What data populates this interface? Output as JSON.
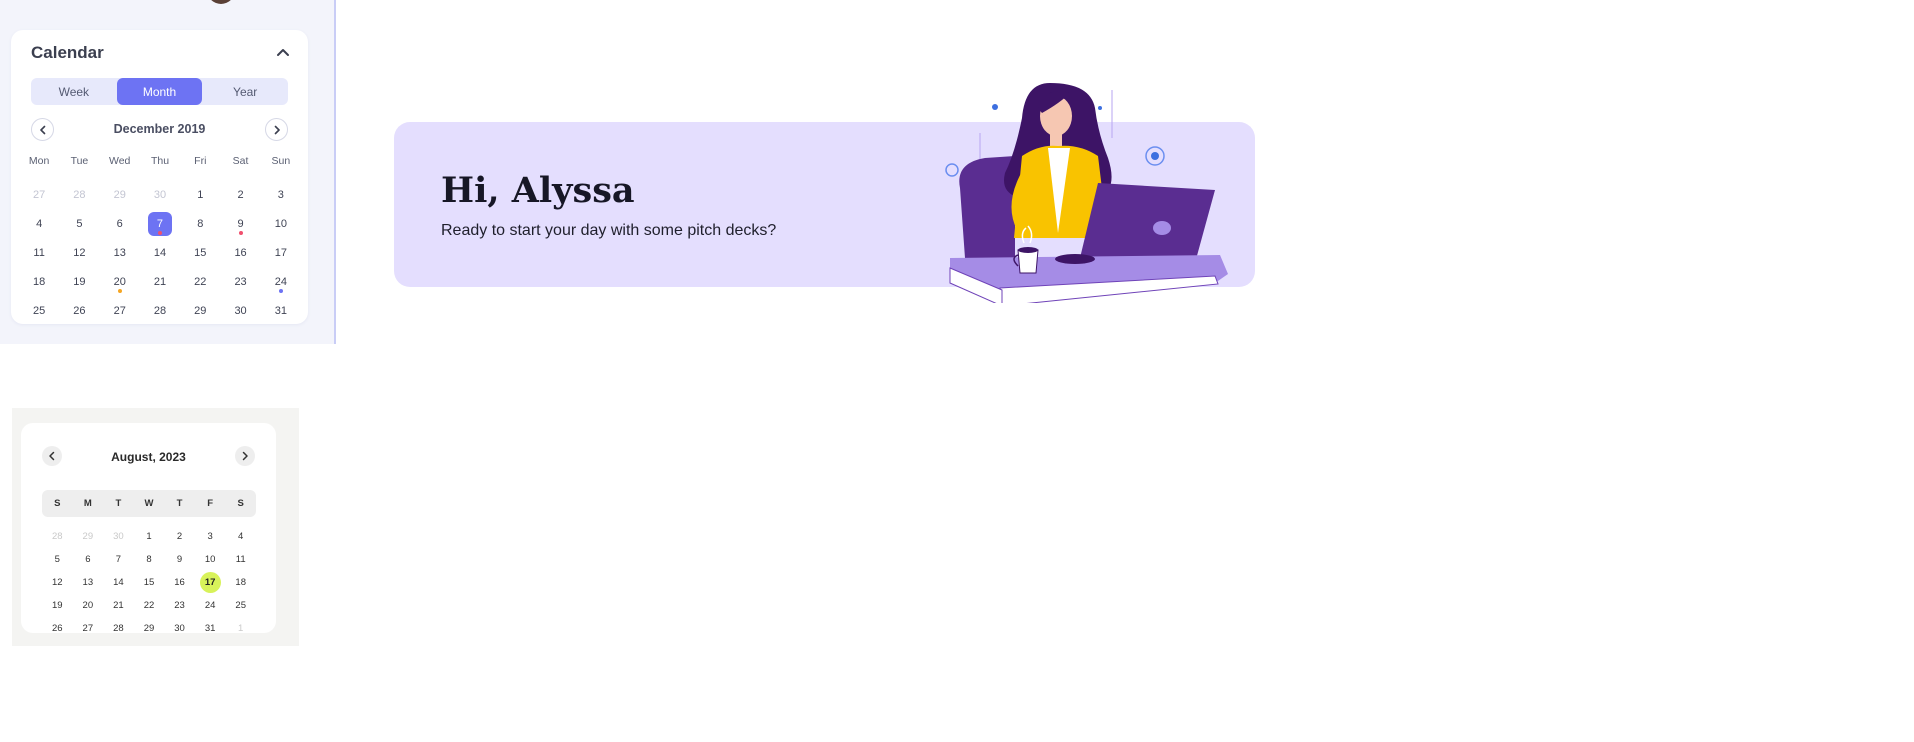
{
  "calendar": {
    "title": "Calendar",
    "views": [
      "Week",
      "Month",
      "Year"
    ],
    "active_view": "Month",
    "month_label": "December 2019",
    "weekdays": [
      "Mon",
      "Tue",
      "Wed",
      "Thu",
      "Fri",
      "Sat",
      "Sun"
    ],
    "accent_color": "#6d73f3",
    "weeks": [
      [
        {
          "d": "27",
          "muted": true
        },
        {
          "d": "28",
          "muted": true
        },
        {
          "d": "29",
          "muted": true
        },
        {
          "d": "30",
          "muted": true
        },
        {
          "d": "1"
        },
        {
          "d": "2"
        },
        {
          "d": "3"
        }
      ],
      [
        {
          "d": "4"
        },
        {
          "d": "5"
        },
        {
          "d": "6"
        },
        {
          "d": "7",
          "selected": true,
          "dot": "#f0506e"
        },
        {
          "d": "8"
        },
        {
          "d": "9",
          "dot": "#f0506e"
        },
        {
          "d": "10"
        }
      ],
      [
        {
          "d": "11"
        },
        {
          "d": "12"
        },
        {
          "d": "13"
        },
        {
          "d": "14"
        },
        {
          "d": "15"
        },
        {
          "d": "16"
        },
        {
          "d": "17"
        }
      ],
      [
        {
          "d": "18"
        },
        {
          "d": "19"
        },
        {
          "d": "20",
          "dot": "#f5a623"
        },
        {
          "d": "21"
        },
        {
          "d": "22"
        },
        {
          "d": "23"
        },
        {
          "d": "24",
          "dot": "#6d73f3"
        }
      ],
      [
        {
          "d": "25"
        },
        {
          "d": "26"
        },
        {
          "d": "27"
        },
        {
          "d": "28"
        },
        {
          "d": "29"
        },
        {
          "d": "30"
        },
        {
          "d": "31"
        }
      ]
    ]
  },
  "banner": {
    "greeting": "Hi, Alyssa",
    "subtitle": "Ready to start your day with some pitch decks?",
    "background": "#e4defe"
  },
  "mini_calendar": {
    "title": "August, 2023",
    "weekdays": [
      "S",
      "M",
      "T",
      "W",
      "T",
      "F",
      "S"
    ],
    "today_color": "#d8f25a",
    "weeks": [
      [
        {
          "d": "28",
          "muted": true
        },
        {
          "d": "29",
          "muted": true
        },
        {
          "d": "30",
          "muted": true
        },
        {
          "d": "1"
        },
        {
          "d": "2"
        },
        {
          "d": "3"
        },
        {
          "d": "4"
        }
      ],
      [
        {
          "d": "5"
        },
        {
          "d": "6"
        },
        {
          "d": "7"
        },
        {
          "d": "8"
        },
        {
          "d": "9"
        },
        {
          "d": "10"
        },
        {
          "d": "11"
        }
      ],
      [
        {
          "d": "12"
        },
        {
          "d": "13"
        },
        {
          "d": "14"
        },
        {
          "d": "15"
        },
        {
          "d": "16"
        },
        {
          "d": "17",
          "today": true
        },
        {
          "d": "18"
        }
      ],
      [
        {
          "d": "19"
        },
        {
          "d": "20"
        },
        {
          "d": "21"
        },
        {
          "d": "22"
        },
        {
          "d": "23"
        },
        {
          "d": "24"
        },
        {
          "d": "25"
        }
      ],
      [
        {
          "d": "26"
        },
        {
          "d": "27"
        },
        {
          "d": "28"
        },
        {
          "d": "29"
        },
        {
          "d": "30"
        },
        {
          "d": "31"
        },
        {
          "d": "1",
          "muted": true
        }
      ]
    ]
  }
}
